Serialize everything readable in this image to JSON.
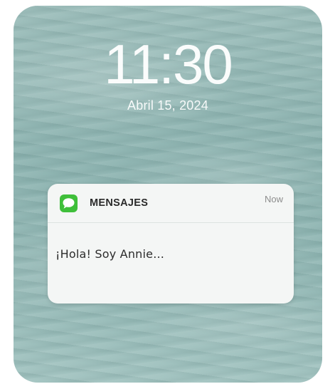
{
  "lock_screen": {
    "time": "11:30",
    "date": "Abril 15, 2024"
  },
  "notification": {
    "app_icon": "messages-icon",
    "app_name": "MENSAJES",
    "time": "Now",
    "message": "¡Hola! Soy Annie..."
  },
  "colors": {
    "app_icon_bg": "#3fbf3a",
    "card_bg": "#f4f6f5",
    "wallpaper": "#93b8b5"
  }
}
